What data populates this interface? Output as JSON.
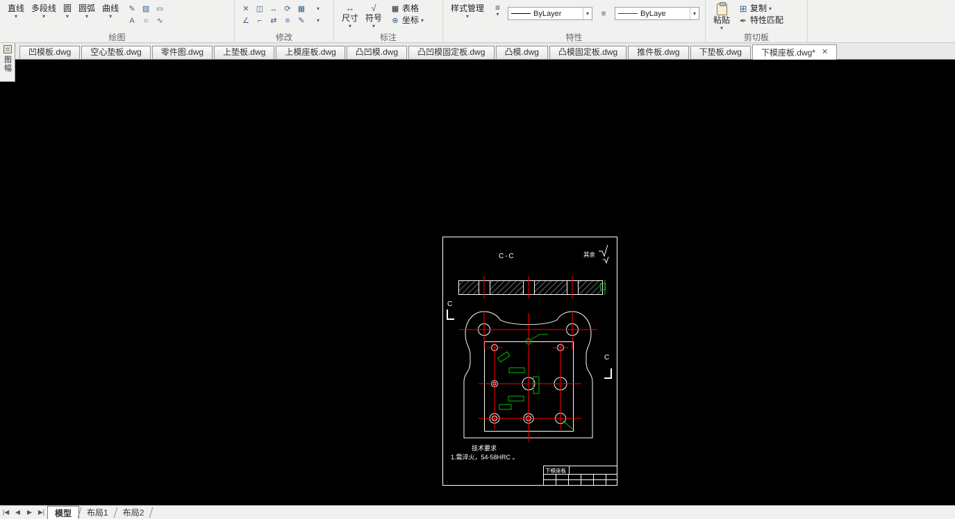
{
  "colors": {
    "centerline_red": "#ff0000",
    "feature_green": "#00bf00",
    "canvas_black": "#000000"
  },
  "ribbon": {
    "panels": {
      "draw": {
        "label": "绘图",
        "tools": [
          {
            "label": "直线"
          },
          {
            "label": "多段线"
          },
          {
            "label": "圆"
          },
          {
            "label": "圆弧"
          },
          {
            "label": "曲线"
          }
        ]
      },
      "modify": {
        "label": "修改"
      },
      "annotate": {
        "label": "标注",
        "dimension": "尺寸",
        "symbol": "符号",
        "table": "表格",
        "coordinate": "坐标"
      },
      "properties": {
        "label": "特性",
        "style_manager": "样式管理",
        "linetype_value": "ByLayer",
        "color_value": "ByLayer"
      },
      "clipboard": {
        "label": "剪切板",
        "paste": "粘贴",
        "copy": "复制",
        "match_properties": "特性匹配"
      }
    }
  },
  "side_tab": {
    "label": "图幅"
  },
  "file_tabs": [
    {
      "label": "凹模板.dwg"
    },
    {
      "label": "空心垫板.dwg"
    },
    {
      "label": "零件图.dwg"
    },
    {
      "label": "上垫板.dwg"
    },
    {
      "label": "上模座板.dwg"
    },
    {
      "label": "凸凹模.dwg"
    },
    {
      "label": "凸凹模固定板.dwg"
    },
    {
      "label": "凸模.dwg"
    },
    {
      "label": "凸模固定板.dwg"
    },
    {
      "label": "推件板.dwg"
    },
    {
      "label": "下垫板.dwg"
    },
    {
      "label": "下模座板.dwg*",
      "active": true
    }
  ],
  "drawing": {
    "section_title": "C-C",
    "surface_note": "其余",
    "cut_label": "C",
    "tech_requirements_title": "技术要求",
    "tech_requirements_item": "1.需淬火，54-58HRC 。",
    "title_block_name": "下模座板"
  },
  "status_bar": {
    "nav": [
      "|◀",
      "◀",
      "▶",
      "▶|"
    ],
    "tabs": [
      {
        "label": "模型",
        "active": true
      },
      {
        "label": "布局1"
      },
      {
        "label": "布局2"
      }
    ]
  }
}
